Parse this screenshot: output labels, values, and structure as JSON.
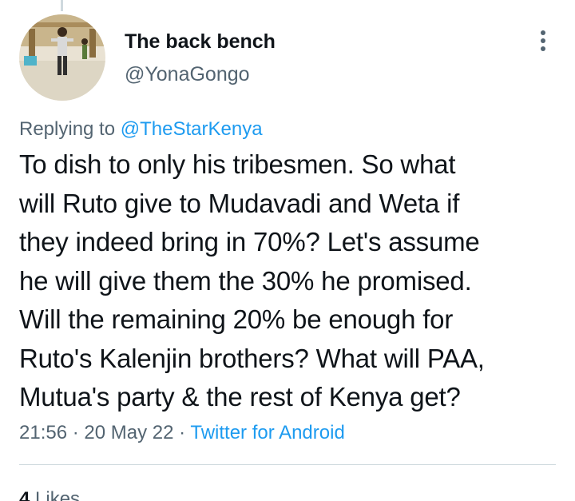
{
  "author": {
    "display_name": "The back bench",
    "handle": "@YonaGongo"
  },
  "reply": {
    "prefix": "Replying to ",
    "mention": "@TheStarKenya"
  },
  "tweet": {
    "lines": [
      "To dish to only his tribesmen. So what",
      "will Ruto give to Mudavadi and Weta if",
      "they indeed bring in 70%? Let's assume",
      "he will give them the 30% he promised.",
      "Will the remaining 20% be enough for",
      "Ruto's Kalenjin brothers? What will PAA,",
      "Mutua's party & the rest of Kenya get?"
    ]
  },
  "meta": {
    "time": "21:56",
    "separator": " · ",
    "date": "20 May 22",
    "source": "Twitter for Android"
  },
  "stats": {
    "likes_count": "4",
    "likes_label": "Likes"
  },
  "icons": {
    "more": "more-vertical-icon"
  },
  "colors": {
    "link": "#1d9bf0",
    "secondary_text": "#536471",
    "primary_text": "#0f1419",
    "divider": "#cfd9de"
  }
}
